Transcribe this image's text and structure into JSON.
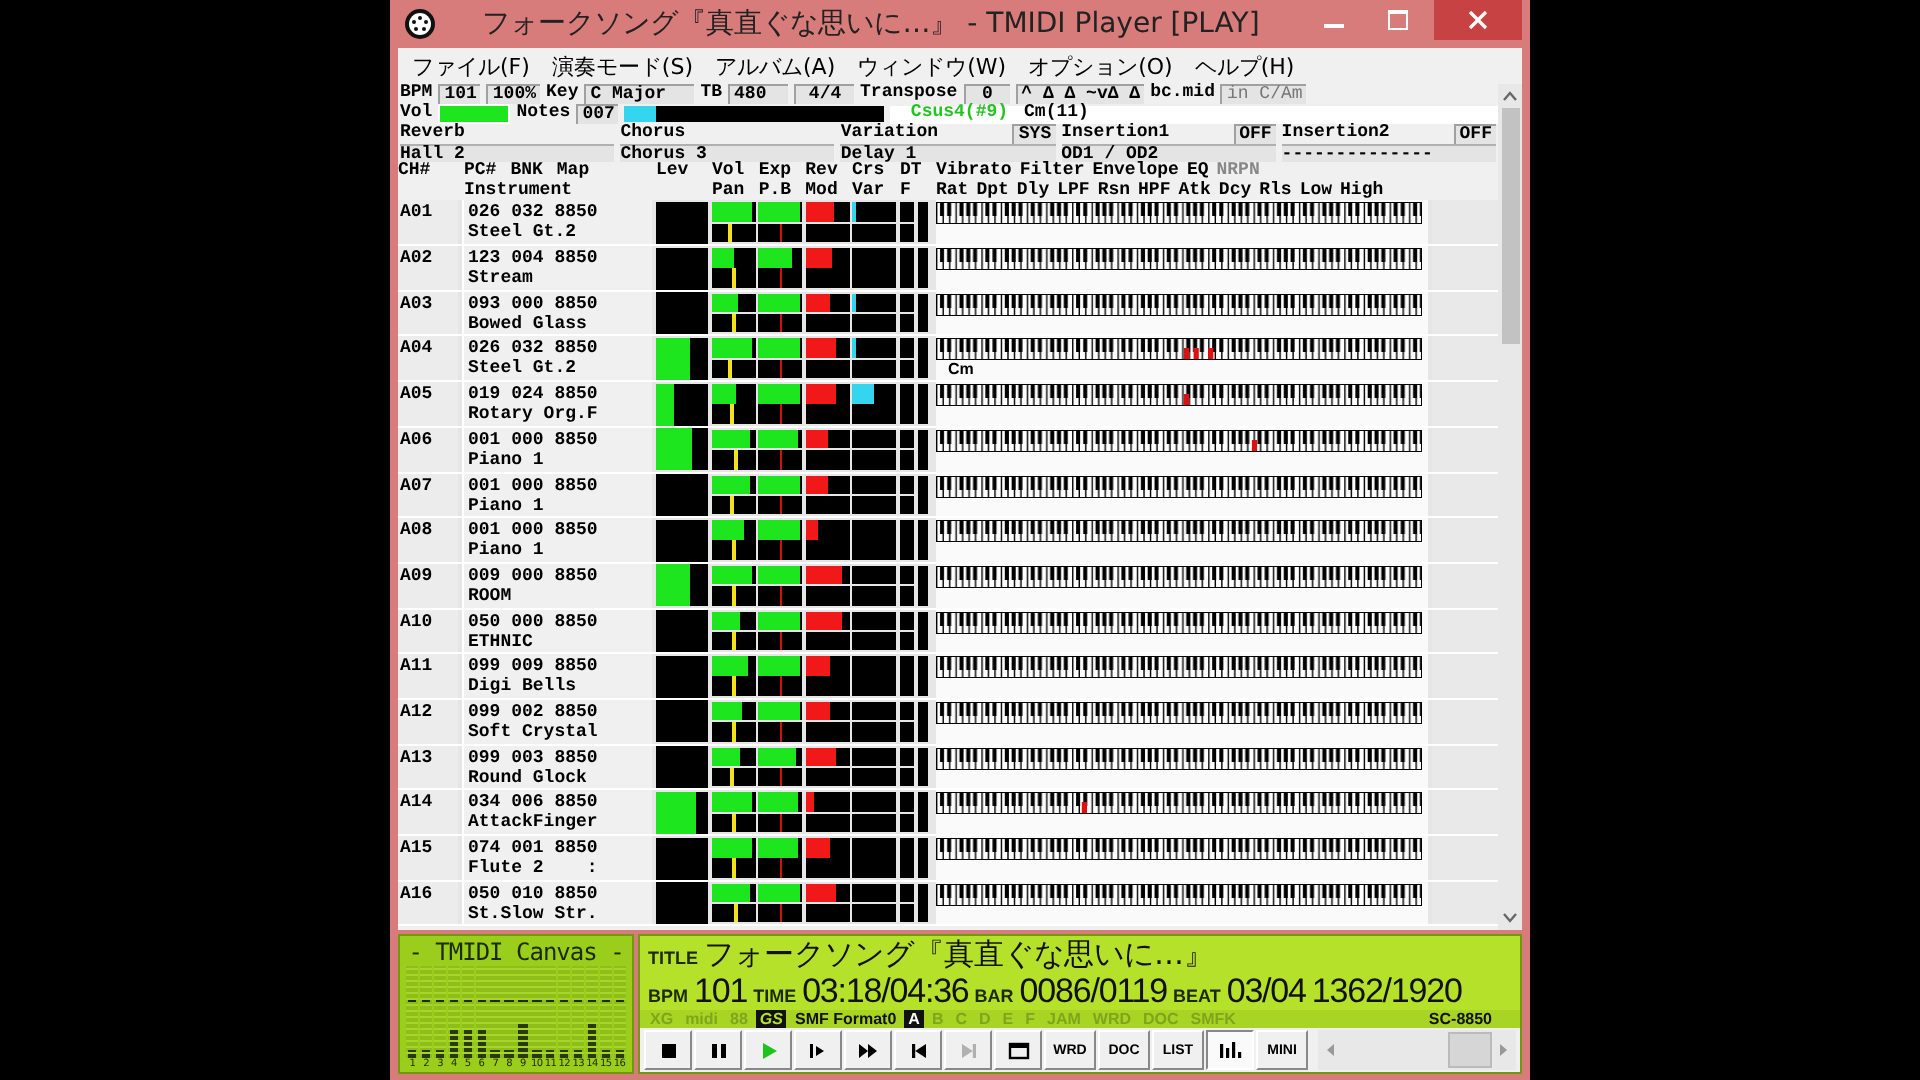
{
  "window": {
    "title": "フォークソング『真直ぐな思いに…』 - TMIDI Player [PLAY]"
  },
  "menu": [
    "ファイル(F)",
    "演奏モード(S)",
    "アルバム(A)",
    "ウィンドウ(W)",
    "オプション(O)",
    "ヘルプ(H)"
  ],
  "status": {
    "bpm_label": "BPM",
    "bpm": "101",
    "tempo_ratio": "100%",
    "key_label": "Key",
    "key": "C Major",
    "tb_label": "TB",
    "tb": "480",
    "meter": "4/4",
    "transpose_label": "Transpose",
    "transpose": "0",
    "marks": "^  Δ Δ ~vΔ Δ",
    "file": "bc.mid",
    "key_hint": "in C/Am",
    "vol_label": "Vol",
    "volume": {
      "level": 1
    },
    "notes_label": "Notes",
    "notes": "007",
    "notes_meter": {
      "level": 0.12
    },
    "chord": "Csus4(#9)",
    "chord_alt": "Cm(11)"
  },
  "effects": [
    {
      "label": "Reverb",
      "value": "Hall 2"
    },
    {
      "label": "Chorus",
      "value": "Chorus 3"
    },
    {
      "label": "Variation",
      "tag": "SYS",
      "value": "Delay 1"
    },
    {
      "label": "Insertion1",
      "tag": "OFF",
      "value": "OD1 / OD2"
    },
    {
      "label": "Insertion2",
      "tag": "OFF",
      "value": "--------------"
    }
  ],
  "header_top": {
    "ch": [
      "CH#"
    ],
    "info": [
      "PC#",
      "BNK",
      "Map"
    ],
    "lev": [
      "Lev"
    ],
    "meter": [
      "Vol",
      "Exp",
      "Rev",
      "Crs"
    ],
    "dt": [
      "DT"
    ],
    "param": [
      {
        "label": "Vibrato",
        "disabled": false
      },
      {
        "label": "Filter",
        "disabled": false
      },
      {
        "label": "Envelope",
        "disabled": false
      },
      {
        "label": "EQ",
        "disabled": false
      },
      {
        "label": "NRPN",
        "disabled": true
      }
    ]
  },
  "header_bottom": {
    "info": [
      "Instrument"
    ],
    "meter": [
      "Pan",
      "P.B",
      "Mod",
      "Var"
    ],
    "dt": [
      "F"
    ],
    "param": [
      "Rat",
      "Dpt",
      "Dly",
      "LPF",
      "Rsn",
      "HPF",
      "Atk",
      "Dcy",
      "Rls",
      "Low",
      "High"
    ]
  },
  "channels": [
    {
      "ch": "A01",
      "pc": "026",
      "bnk": "032",
      "map": "8850",
      "instrument": "Steel Gt.2",
      "lev": {
        "level": 0
      },
      "vol": {
        "level": 0.9
      },
      "exp": {
        "level": 0.92
      },
      "rev": {
        "level": 0.65
      },
      "crs": {
        "level": 0.1
      },
      "pan": {
        "level": 0.4
      }
    },
    {
      "ch": "A02",
      "pc": "123",
      "bnk": "004",
      "map": "8850",
      "instrument": "Stream",
      "lev": {
        "level": 0
      },
      "vol": {
        "level": 0.5
      },
      "exp": {
        "level": 0.75
      },
      "rev": {
        "level": 0.6
      },
      "crs": {
        "level": 0
      },
      "pan": {
        "level": 0.5
      }
    },
    {
      "ch": "A03",
      "pc": "093",
      "bnk": "000",
      "map": "8850",
      "instrument": "Bowed Glass",
      "lev": {
        "level": 0
      },
      "vol": {
        "level": 0.6
      },
      "exp": {
        "level": 0.95
      },
      "rev": {
        "level": 0.55
      },
      "crs": {
        "level": 0.1
      },
      "pan": {
        "level": 0.5
      }
    },
    {
      "ch": "A04",
      "pc": "026",
      "bnk": "032",
      "map": "8850",
      "instrument": "Steel Gt.2",
      "lev": {
        "level": 0.65
      },
      "vol": {
        "level": 0.9
      },
      "exp": {
        "level": 0.95
      },
      "rev": {
        "level": 0.7
      },
      "crs": {
        "level": 0.1
      },
      "pan": {
        "level": 0.4
      },
      "keys": [
        {
          "level": 0.51
        },
        {
          "level": 0.53
        },
        {
          "level": 0.56
        }
      ],
      "chord": "Cm"
    },
    {
      "ch": "A05",
      "pc": "019",
      "bnk": "024",
      "map": "8850",
      "instrument": "Rotary Org.F",
      "lev": {
        "level": 0.35
      },
      "vol": {
        "level": 0.55
      },
      "exp": {
        "level": 0.95
      },
      "rev": {
        "level": 0.7
      },
      "crs": {
        "level": 0.5
      },
      "pan": {
        "level": 0.45
      },
      "keys": [
        {
          "level": 0.51
        }
      ]
    },
    {
      "ch": "A06",
      "pc": "001",
      "bnk": "000",
      "map": "8850",
      "instrument": "Piano 1",
      "lev": {
        "level": 0.7
      },
      "vol": {
        "level": 0.85
      },
      "exp": {
        "level": 0.9
      },
      "rev": {
        "level": 0.5
      },
      "crs": {
        "level": 0
      },
      "pan": {
        "level": 0.55
      },
      "keys": [
        {
          "level": 0.65
        }
      ]
    },
    {
      "ch": "A07",
      "pc": "001",
      "bnk": "000",
      "map": "8850",
      "instrument": "Piano 1",
      "lev": {
        "level": 0
      },
      "vol": {
        "level": 0.85
      },
      "exp": {
        "level": 0.95
      },
      "rev": {
        "level": 0.5
      },
      "crs": {
        "level": 0
      },
      "pan": {
        "level": 0.45
      }
    },
    {
      "ch": "A08",
      "pc": "001",
      "bnk": "000",
      "map": "8850",
      "instrument": "Piano 1",
      "lev": {
        "level": 0
      },
      "vol": {
        "level": 0.75
      },
      "exp": {
        "level": 0.95
      },
      "rev": {
        "level": 0.3
      },
      "crs": {
        "level": 0
      },
      "pan": {
        "level": 0.5
      }
    },
    {
      "ch": "A09",
      "pc": "009",
      "bnk": "000",
      "map": "8850",
      "instrument": "ROOM",
      "lev": {
        "level": 0.65
      },
      "vol": {
        "level": 0.9
      },
      "exp": {
        "level": 0.95
      },
      "rev": {
        "level": 0.85
      },
      "crs": {
        "level": 0
      },
      "pan": {
        "level": 0.5
      }
    },
    {
      "ch": "A10",
      "pc": "050",
      "bnk": "000",
      "map": "8850",
      "instrument": "ETHNIC",
      "lev": {
        "level": 0
      },
      "vol": {
        "level": 0.65
      },
      "exp": {
        "level": 0.95
      },
      "rev": {
        "level": 0.85
      },
      "crs": {
        "level": 0
      },
      "pan": {
        "level": 0.5
      }
    },
    {
      "ch": "A11",
      "pc": "099",
      "bnk": "009",
      "map": "8850",
      "instrument": "Digi Bells",
      "lev": {
        "level": 0
      },
      "vol": {
        "level": 0.8
      },
      "exp": {
        "level": 0.95
      },
      "rev": {
        "level": 0.55
      },
      "crs": {
        "level": 0
      },
      "pan": {
        "level": 0.5
      }
    },
    {
      "ch": "A12",
      "pc": "099",
      "bnk": "002",
      "map": "8850",
      "instrument": "Soft Crystal",
      "lev": {
        "level": 0
      },
      "vol": {
        "level": 0.7
      },
      "exp": {
        "level": 0.95
      },
      "rev": {
        "level": 0.55
      },
      "crs": {
        "level": 0
      },
      "pan": {
        "level": 0.5
      }
    },
    {
      "ch": "A13",
      "pc": "099",
      "bnk": "003",
      "map": "8850",
      "instrument": "Round Glock",
      "lev": {
        "level": 0
      },
      "vol": {
        "level": 0.65
      },
      "exp": {
        "level": 0.85
      },
      "rev": {
        "level": 0.7
      },
      "crs": {
        "level": 0
      },
      "pan": {
        "level": 0.45
      }
    },
    {
      "ch": "A14",
      "pc": "034",
      "bnk": "006",
      "map": "8850",
      "instrument": "AttackFinger",
      "lev": {
        "level": 0.75
      },
      "vol": {
        "level": 0.9
      },
      "exp": {
        "level": 0.9
      },
      "rev": {
        "level": 0.2
      },
      "crs": {
        "level": 0
      },
      "pan": {
        "level": 0.5
      },
      "keys": [
        {
          "level": 0.3
        }
      ]
    },
    {
      "ch": "A15",
      "pc": "074",
      "bnk": "001",
      "map": "8850",
      "instrument": "Flute 2    :",
      "lev": {
        "level": 0
      },
      "vol": {
        "level": 0.9
      },
      "exp": {
        "level": 0.9
      },
      "rev": {
        "level": 0.55
      },
      "crs": {
        "level": 0
      },
      "pan": {
        "level": 0.5
      }
    },
    {
      "ch": "A16",
      "pc": "050",
      "bnk": "010",
      "map": "8850",
      "instrument": "St.Slow Str.",
      "lev": {
        "level": 0
      },
      "vol": {
        "level": 0.85
      },
      "exp": {
        "level": 0.95
      },
      "rev": {
        "level": 0.7
      },
      "crs": {
        "level": 0
      },
      "pan": {
        "level": 0.55
      }
    }
  ],
  "canvas": {
    "title": "- TMIDI Canvas -",
    "bands": [
      {
        "label": "1",
        "level": 0.08
      },
      {
        "label": "2",
        "level": 0.08
      },
      {
        "label": "3",
        "level": 0.08
      },
      {
        "label": "4",
        "level": 0.3
      },
      {
        "label": "5",
        "level": 0.3
      },
      {
        "label": "6",
        "level": 0.3
      },
      {
        "label": "7",
        "level": 0.08
      },
      {
        "label": "8",
        "level": 0.08
      },
      {
        "label": "9",
        "level": 0.4
      },
      {
        "label": "10",
        "level": 0.08
      },
      {
        "label": "11",
        "level": 0.08
      },
      {
        "label": "12",
        "level": 0.08
      },
      {
        "label": "13",
        "level": 0.08
      },
      {
        "label": "14",
        "level": 0.4
      },
      {
        "label": "15",
        "level": 0.08
      },
      {
        "label": "16",
        "level": 0.08
      }
    ]
  },
  "now_playing": {
    "title_label": "TITLE",
    "title": "フォークソング『真直ぐな思いに…』",
    "bpm_label": "BPM",
    "bpm": "101",
    "time_label": "TIME",
    "time": "03:18/04:36",
    "bar_label": "BAR",
    "bar": "0086/0119",
    "beat_label": "BEAT",
    "beat": "03/04",
    "tick": "1362/1920"
  },
  "indicators": [
    {
      "label": "XG",
      "kind": "logo",
      "on": false
    },
    {
      "label": "midi",
      "kind": "text",
      "on": false
    },
    {
      "label": "88",
      "kind": "text",
      "on": false
    },
    {
      "label": "GS",
      "kind": "logo",
      "on": true
    },
    {
      "label": "SMF Format0",
      "kind": "text",
      "on": true
    },
    {
      "label": "A",
      "kind": "port",
      "on": true
    },
    {
      "label": "B",
      "kind": "port",
      "on": false
    },
    {
      "label": "C",
      "kind": "port",
      "on": false
    },
    {
      "label": "D",
      "kind": "port",
      "on": false
    },
    {
      "label": "E",
      "kind": "port",
      "on": false
    },
    {
      "label": "F",
      "kind": "port",
      "on": false
    },
    {
      "label": "JAM",
      "kind": "text",
      "on": false
    },
    {
      "label": "WRD",
      "kind": "text",
      "on": false
    },
    {
      "label": "DOC",
      "kind": "text",
      "on": false
    },
    {
      "label": "SMFK",
      "kind": "text",
      "on": false
    },
    {
      "label": "SC-8850",
      "kind": "text",
      "on": true
    }
  ],
  "buttons": [
    {
      "kind": "stop",
      "pressed": false,
      "disabled": false
    },
    {
      "kind": "pause",
      "pressed": false,
      "disabled": false
    },
    {
      "kind": "play",
      "pressed": false,
      "disabled": false
    },
    {
      "kind": "step",
      "pressed": false,
      "disabled": false
    },
    {
      "kind": "forward",
      "pressed": false,
      "disabled": false
    },
    {
      "kind": "previous",
      "pressed": false,
      "disabled": false
    },
    {
      "kind": "next",
      "pressed": false,
      "disabled": true
    },
    {
      "kind": "window",
      "pressed": false,
      "disabled": false
    },
    {
      "kind": "text",
      "label": "WRD",
      "pressed": false,
      "disabled": false
    },
    {
      "kind": "text",
      "label": "DOC",
      "pressed": false,
      "disabled": false
    },
    {
      "kind": "text",
      "label": "LIST",
      "pressed": false,
      "disabled": false
    },
    {
      "kind": "bars",
      "pressed": true,
      "disabled": false
    },
    {
      "kind": "text",
      "label": "MINI",
      "pressed": false,
      "disabled": false
    }
  ]
}
